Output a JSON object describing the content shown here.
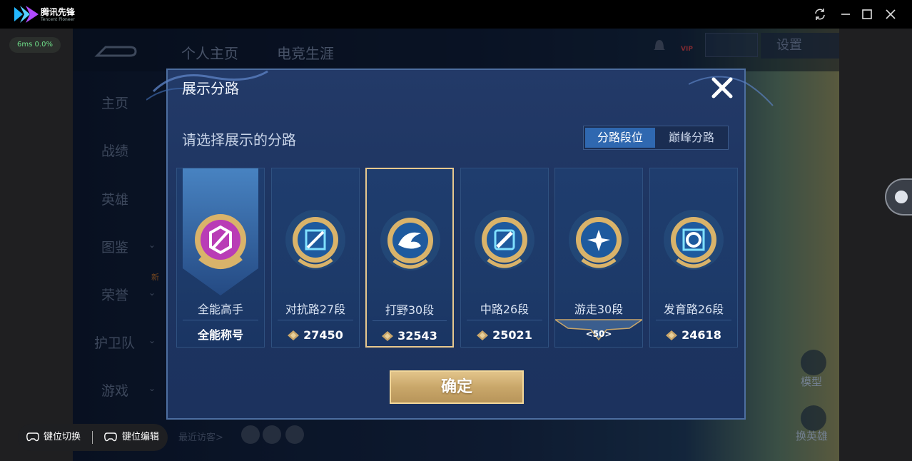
{
  "app": {
    "name": "腾讯先锋",
    "subtitle": "Tencent Pioneer"
  },
  "window_controls": [
    "refresh-icon",
    "minimize-icon",
    "maximize-icon",
    "close-icon"
  ],
  "perf": {
    "text": "6ms  0.0%"
  },
  "game_bg": {
    "tabs": [
      "个人主页",
      "电竞生涯"
    ],
    "settings": "设置",
    "vip": "VIP",
    "nav": [
      "主页",
      "战绩",
      "英雄",
      "图鉴",
      "荣誉",
      "护卫队",
      "游戏"
    ],
    "new_tag": "新",
    "visitors": "最近访客>",
    "side_labels": [
      "模型",
      "换英雄"
    ]
  },
  "dialog": {
    "title": "展示分路",
    "subtitle": "请选择展示的分路",
    "segment": {
      "active": "分路段位",
      "inactive": "巅峰分路"
    },
    "cards": [
      {
        "name": "全能高手",
        "footer": "全能称号",
        "score": null,
        "selected": false
      },
      {
        "name": "对抗路27段",
        "score": "27450",
        "selected": false
      },
      {
        "name": "打野30段",
        "score": "32543",
        "selected": true
      },
      {
        "name": "中路26段",
        "score": "25021",
        "selected": false
      },
      {
        "name": "游走30段",
        "badge": "50",
        "selected": false
      },
      {
        "name": "发育路26段",
        "score": "24618",
        "selected": false
      }
    ],
    "confirm": "确定"
  },
  "keybar": {
    "switch": "键位切换",
    "edit": "键位编辑"
  },
  "colors": {
    "accent_gold": "#e8c88e",
    "seg_active": "#2f68b0",
    "dialog_bg": "#1e3562"
  }
}
